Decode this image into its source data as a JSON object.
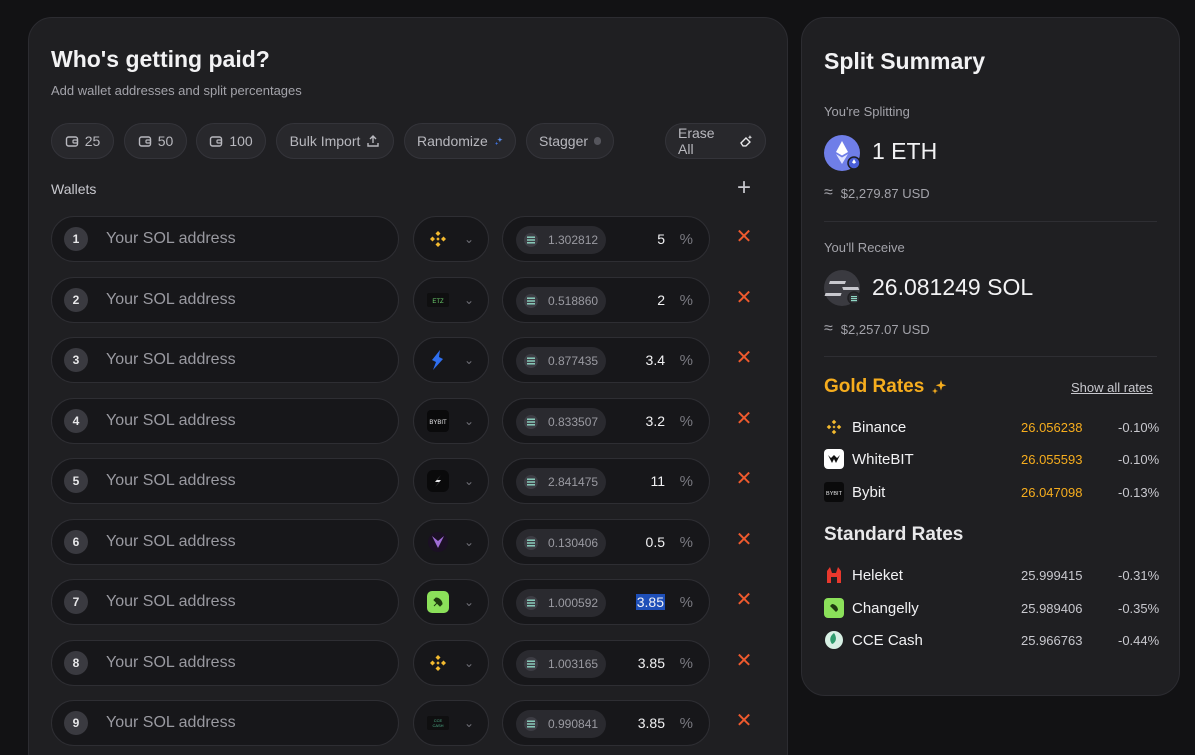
{
  "left": {
    "title": "Who's getting paid?",
    "subtitle": "Add wallet addresses and split percentages",
    "chips": {
      "c25": "25",
      "c50": "50",
      "c100": "100",
      "bulk": "Bulk Import",
      "randomize": "Randomize",
      "stagger": "Stagger",
      "erase": "Erase All"
    },
    "wallets_label": "Wallets",
    "rows": [
      {
        "n": "1",
        "placeholder": "Your SOL address",
        "exchange": "binance-logo",
        "amount": "1.302812",
        "percent": "5"
      },
      {
        "n": "2",
        "placeholder": "Your SOL address",
        "exchange": "etz-logo",
        "amount": "0.518860",
        "percent": "2"
      },
      {
        "n": "3",
        "placeholder": "Your SOL address",
        "exchange": "blue-logo",
        "amount": "0.877435",
        "percent": "3.4"
      },
      {
        "n": "4",
        "placeholder": "Your SOL address",
        "exchange": "bybit-logo",
        "amount": "0.833507",
        "percent": "3.2"
      },
      {
        "n": "5",
        "placeholder": "Your SOL address",
        "exchange": "s-logo",
        "amount": "2.841475",
        "percent": "11"
      },
      {
        "n": "6",
        "placeholder": "Your SOL address",
        "exchange": "purple-logo",
        "amount": "0.130406",
        "percent": "0.5"
      },
      {
        "n": "7",
        "placeholder": "Your SOL address",
        "exchange": "changelly-logo",
        "amount": "1.000592",
        "percent": "3.85"
      },
      {
        "n": "8",
        "placeholder": "Your SOL address",
        "exchange": "binance-logo",
        "amount": "1.003165",
        "percent": "3.85"
      },
      {
        "n": "9",
        "placeholder": "Your SOL address",
        "exchange": "cce-logo",
        "amount": "0.990841",
        "percent": "3.85"
      }
    ]
  },
  "right": {
    "title": "Split Summary",
    "splitting_label": "You're Splitting",
    "splitting_amount": "1 ETH",
    "splitting_usd": "$2,279.87 USD",
    "receive_label": "You'll Receive",
    "receive_amount": "26.081249 SOL",
    "receive_usd": "$2,257.07 USD",
    "gold_title": "Gold Rates",
    "show_all": "Show all rates",
    "gold_rates": [
      {
        "name": "Binance",
        "rate": "26.056238",
        "pct": "-0.10%"
      },
      {
        "name": "WhiteBIT",
        "rate": "26.055593",
        "pct": "-0.10%"
      },
      {
        "name": "Bybit",
        "rate": "26.047098",
        "pct": "-0.13%"
      }
    ],
    "std_title": "Standard Rates",
    "std_rates": [
      {
        "name": "Heleket",
        "rate": "25.999415",
        "pct": "-0.31%"
      },
      {
        "name": "Changelly",
        "rate": "25.989406",
        "pct": "-0.35%"
      },
      {
        "name": "CCE Cash",
        "rate": "25.966763",
        "pct": "-0.44%"
      }
    ]
  },
  "colors": {
    "accent_gold": "#f6ad1e",
    "delete_red": "#ee5a2e",
    "selection_blue": "#1e4fb8"
  }
}
